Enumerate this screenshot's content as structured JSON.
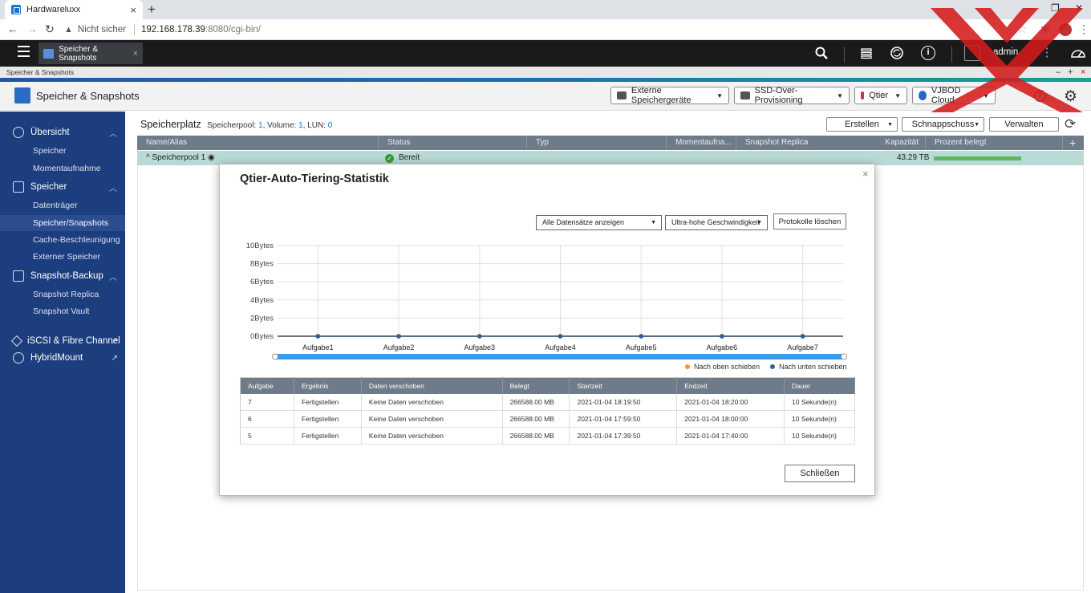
{
  "browser": {
    "tab_title": "Hardwareluxx",
    "tab_close": "×",
    "new_tab": "+",
    "security_label": "Nicht sicher",
    "url_host": "192.168.178.39",
    "url_rest": ":8080/cgi-bin/",
    "win_minimize": "—",
    "win_restore": "❐",
    "win_close": "✕"
  },
  "qts": {
    "app_tab": "Speicher & Snapshots",
    "user": "admin",
    "window_caption": "Speicher & Snapshots"
  },
  "app": {
    "title": "Speicher & Snapshots",
    "buttons": [
      {
        "label": "Externe Speichergeräte"
      },
      {
        "label": "SSD-Over-Provisioning"
      },
      {
        "label": "Qtier"
      },
      {
        "label": "VJBOD Cloud"
      }
    ]
  },
  "sidebar": {
    "groups": [
      {
        "label": "Übersicht",
        "items": [
          "Speicher",
          "Momentaufnahme"
        ]
      },
      {
        "label": "Speicher",
        "items": [
          "Datenträger",
          "Speicher/Snapshots",
          "Cache-Beschleunigung",
          "Externer Speicher"
        ]
      },
      {
        "label": "Snapshot-Backup",
        "items": [
          "Snapshot Replica",
          "Snapshot Vault"
        ]
      }
    ],
    "links": [
      "iSCSI & Fibre Channel",
      "HybridMount"
    ],
    "active_item": "Speicher/Snapshots"
  },
  "storage": {
    "heading": "Speicherplatz",
    "pool_label": "Speicherpool:",
    "pool_count": "1",
    "volume_label": ", Volume:",
    "volume_count": "1",
    "lun_label": ", LUN:",
    "lun_count": "0",
    "btn_create": "Erstellen",
    "btn_snapshot": "Schnappschuss",
    "btn_manage": "Verwalten",
    "columns": [
      "Name/Alias",
      "Status",
      "Typ",
      "Momentaufna...",
      "Snapshot Replica",
      "Kapazität",
      "Prozent belegt"
    ],
    "add": "+",
    "pool_row": {
      "name": "Speicherpool 1",
      "status": "Bereit",
      "capacity": "43.29 TB",
      "percent_used": 0.82
    }
  },
  "dialog": {
    "title": "Qtier-Auto-Tiering-Statistik",
    "close": "×",
    "filter_select": "Alle Datensätze anzeigen",
    "tier_select": "Ultra-hohe Geschwindigkeit",
    "clear_logs_button": "Protokolle löschen",
    "legend_up": "Nach oben schieben",
    "legend_down": "Nach unten schieben",
    "colors": {
      "up": "#f39c2b",
      "down": "#2f5f9e",
      "line": "#2f4a70",
      "slider": "#3a9ae6"
    },
    "table": {
      "headers": [
        "Aufgabe",
        "Ergebnis",
        "Daten verschoben",
        "Belegt",
        "Startzeit",
        "Endzeit",
        "Dauer"
      ],
      "rows": [
        [
          "7",
          "Fertigstellen",
          "Keine Daten verschoben",
          "266588.00 MB",
          "2021-01-04 18:19:50",
          "2021-01-04 18:20:00",
          "10 Sekunde(n)"
        ],
        [
          "6",
          "Fertigstellen",
          "Keine Daten verschoben",
          "266588.00 MB",
          "2021-01-04 17:59:50",
          "2021-01-04 18:00:00",
          "10 Sekunde(n)"
        ],
        [
          "5",
          "Fertigstellen",
          "Keine Daten verschoben",
          "266588.00 MB",
          "2021-01-04 17:39:50",
          "2021-01-04 17:40:00",
          "10 Sekunde(n)"
        ]
      ]
    },
    "close_button": "Schließen"
  },
  "chart_data": {
    "type": "line",
    "categories": [
      "Aufgabe1",
      "Aufgabe2",
      "Aufgabe3",
      "Aufgabe4",
      "Aufgabe5",
      "Aufgabe6",
      "Aufgabe7"
    ],
    "series": [
      {
        "values": [
          0,
          0,
          0,
          0,
          0,
          0,
          0
        ]
      },
      {
        "values": [
          0,
          0,
          0,
          0,
          0,
          0,
          0
        ]
      }
    ],
    "y_ticks": [
      "0Bytes",
      "2Bytes",
      "4Bytes",
      "6Bytes",
      "8Bytes",
      "10Bytes"
    ],
    "ylim": [
      0,
      10
    ],
    "grid": true,
    "legend": "bottom-right"
  },
  "icons": [
    "search-icon",
    "tasks-icon",
    "sync-icon",
    "info-icon",
    "user-icon",
    "more-icon",
    "dashboard-icon",
    "gear-icon",
    "help-icon",
    "refresh-icon"
  ]
}
